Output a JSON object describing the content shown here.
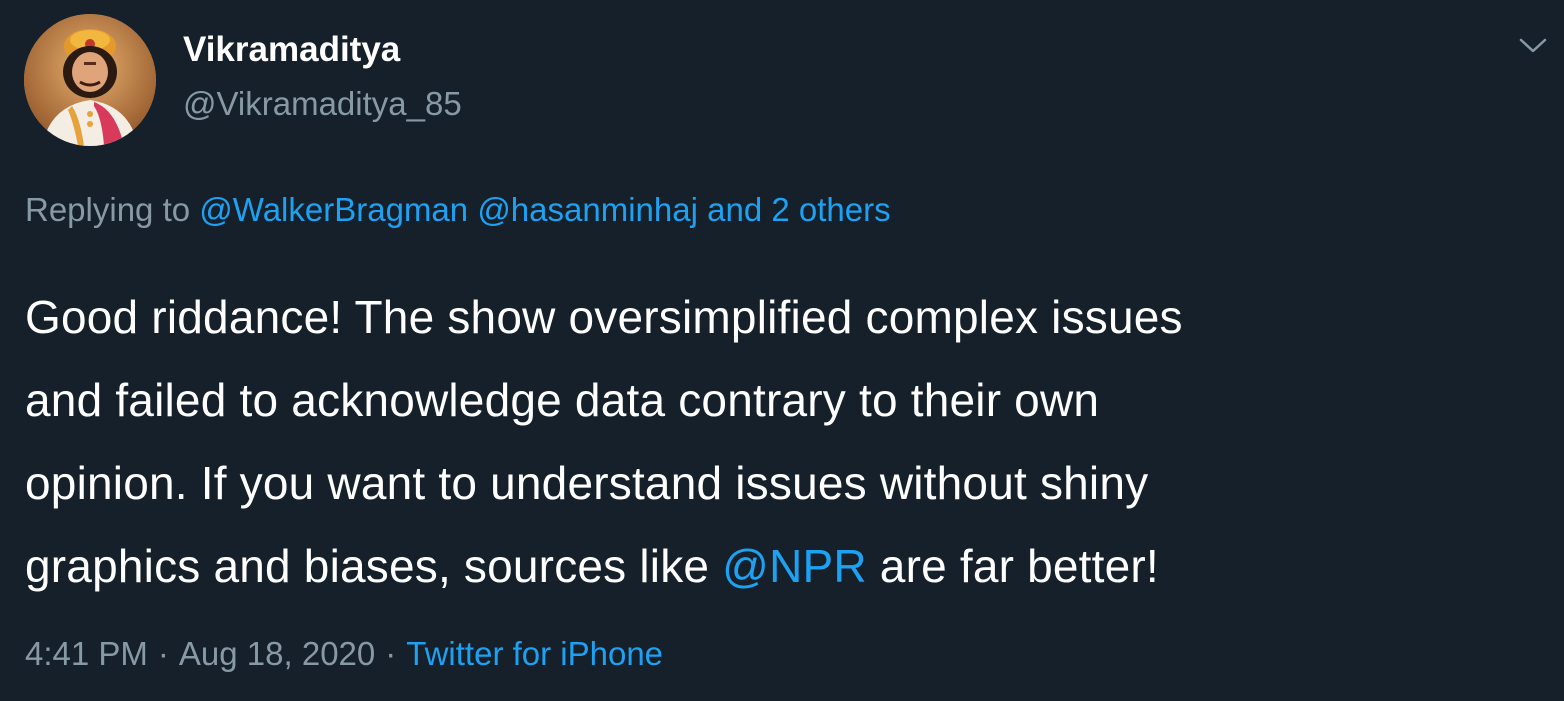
{
  "tweet": {
    "author": {
      "display_name": "Vikramaditya",
      "handle": "@Vikramaditya_85"
    },
    "reply": {
      "prefix": "Replying to",
      "mention_1": "@WalkerBragman",
      "mention_2": "@hasanminhaj",
      "others": "and 2 others"
    },
    "body": {
      "line_1": "Good riddance! The show oversimplified complex issues",
      "line_2": "and failed to acknowledge data contrary to their own",
      "line_3": "opinion. If you want to understand issues without shiny",
      "line_4_before": "graphics and biases, sources like",
      "line_4_mention": "@NPR",
      "line_4_after": "are far better!"
    },
    "meta": {
      "time": "4:41 PM",
      "separator": "·",
      "date": "Aug 18, 2020",
      "source": "Twitter for iPhone"
    }
  },
  "icons": {
    "more": "chevron-down-icon"
  },
  "colors": {
    "background": "#15202b",
    "text": "#ffffff",
    "secondary": "#8899a6",
    "link": "#1da1f2"
  }
}
